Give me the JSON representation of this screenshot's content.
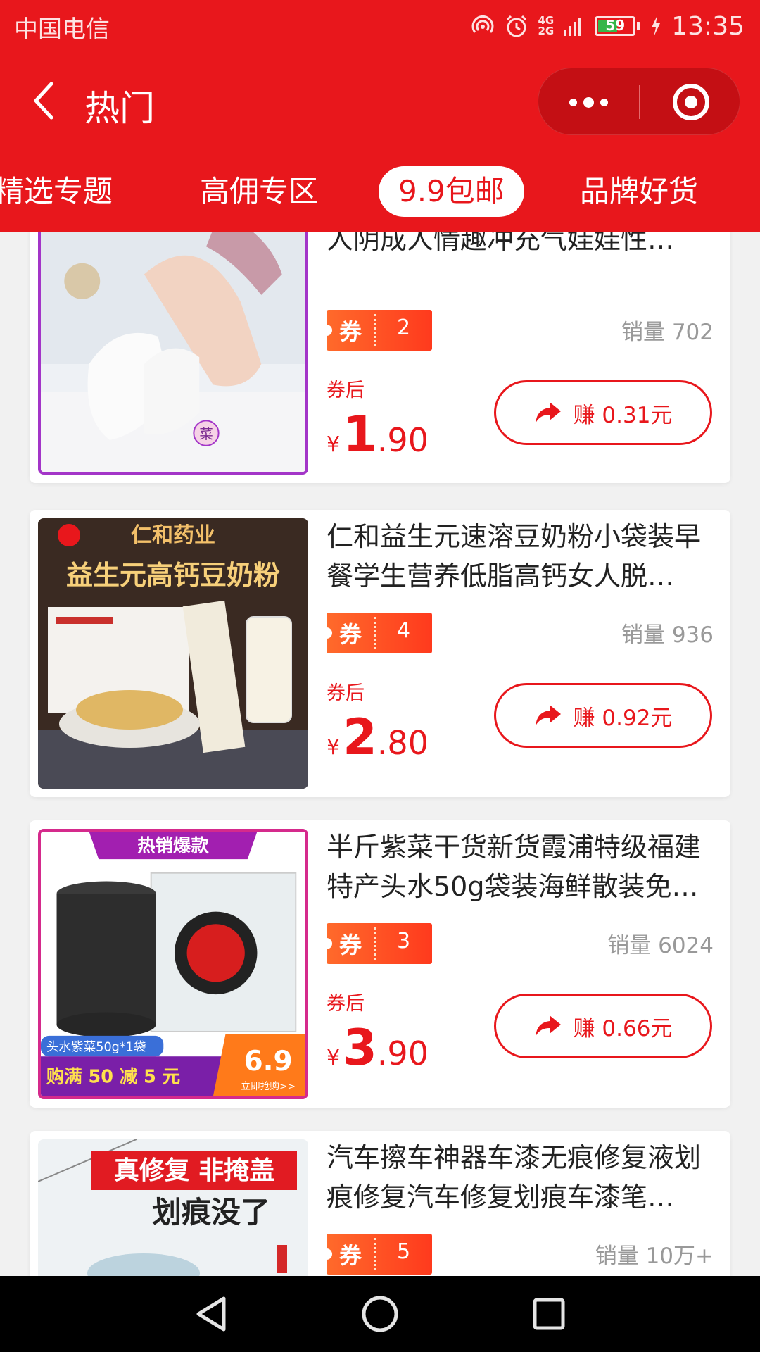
{
  "status_bar": {
    "carrier": "中国电信",
    "network_label_top": "4G",
    "network_label_bottom": "2G",
    "battery_level": "59",
    "battery_percent": 59,
    "time": "13:35"
  },
  "header": {
    "title": "热门",
    "back_icon": "chevron-left-icon",
    "more_icon": "more-dots-icon",
    "close_icon": "target-circle-icon"
  },
  "tabs": [
    {
      "label": "精选专题",
      "active": false
    },
    {
      "label": "高佣专区",
      "active": false
    },
    {
      "label": "9.9包邮",
      "active": true
    },
    {
      "label": "品牌好货",
      "active": false
    }
  ],
  "labels": {
    "coupon": "券",
    "after_coupon": "券后",
    "currency": "¥",
    "sales_prefix": "销量 "
  },
  "products": [
    {
      "title": "自慰器男用飞机杯自器倒模仿真人阴成人情趣冲充气娃娃性…",
      "coupon_value": "2",
      "sales": "销量 702",
      "price_int": "1",
      "price_dec": ".90",
      "earn": "赚 0.31元",
      "image_text": "菜"
    },
    {
      "title": "仁和益生元速溶豆奶粉小袋装早餐学生营养低脂高钙女人脱…",
      "coupon_value": "4",
      "sales": "销量 936",
      "price_int": "2",
      "price_dec": ".80",
      "earn": "赚 0.92元",
      "image_text_top": "仁和药业",
      "image_text_main": "益生元高钙豆奶粉"
    },
    {
      "title": "半斤紫菜干货新货霞浦特级福建特产头水50g袋装海鲜散装免…",
      "coupon_value": "3",
      "sales": "销量 6024",
      "price_int": "3",
      "price_dec": ".90",
      "earn": "赚 0.66元",
      "image_text_banner": "热销爆款",
      "image_text_spec": "头水紫菜50g*1袋",
      "image_text_promo": "购满 50 减 5 元",
      "image_text_price": "6.9",
      "image_text_cta": "立即抢购>>"
    },
    {
      "title": "汽车擦车神器车漆无痕修复液划痕修复汽车修复划痕车漆笔…",
      "coupon_value": "5",
      "sales": "销量 10万+",
      "price_int": "",
      "price_dec": "",
      "earn": "",
      "image_text_line1": "真修复 非掩盖",
      "image_text_line2": "划痕没了"
    }
  ],
  "colors": {
    "brand_red": "#e8171c",
    "coupon_orange": "#ff5a24",
    "nav_black": "#000000"
  },
  "nav": {
    "back": "triangle-back-icon",
    "home": "circle-home-icon",
    "recents": "square-recents-icon"
  }
}
